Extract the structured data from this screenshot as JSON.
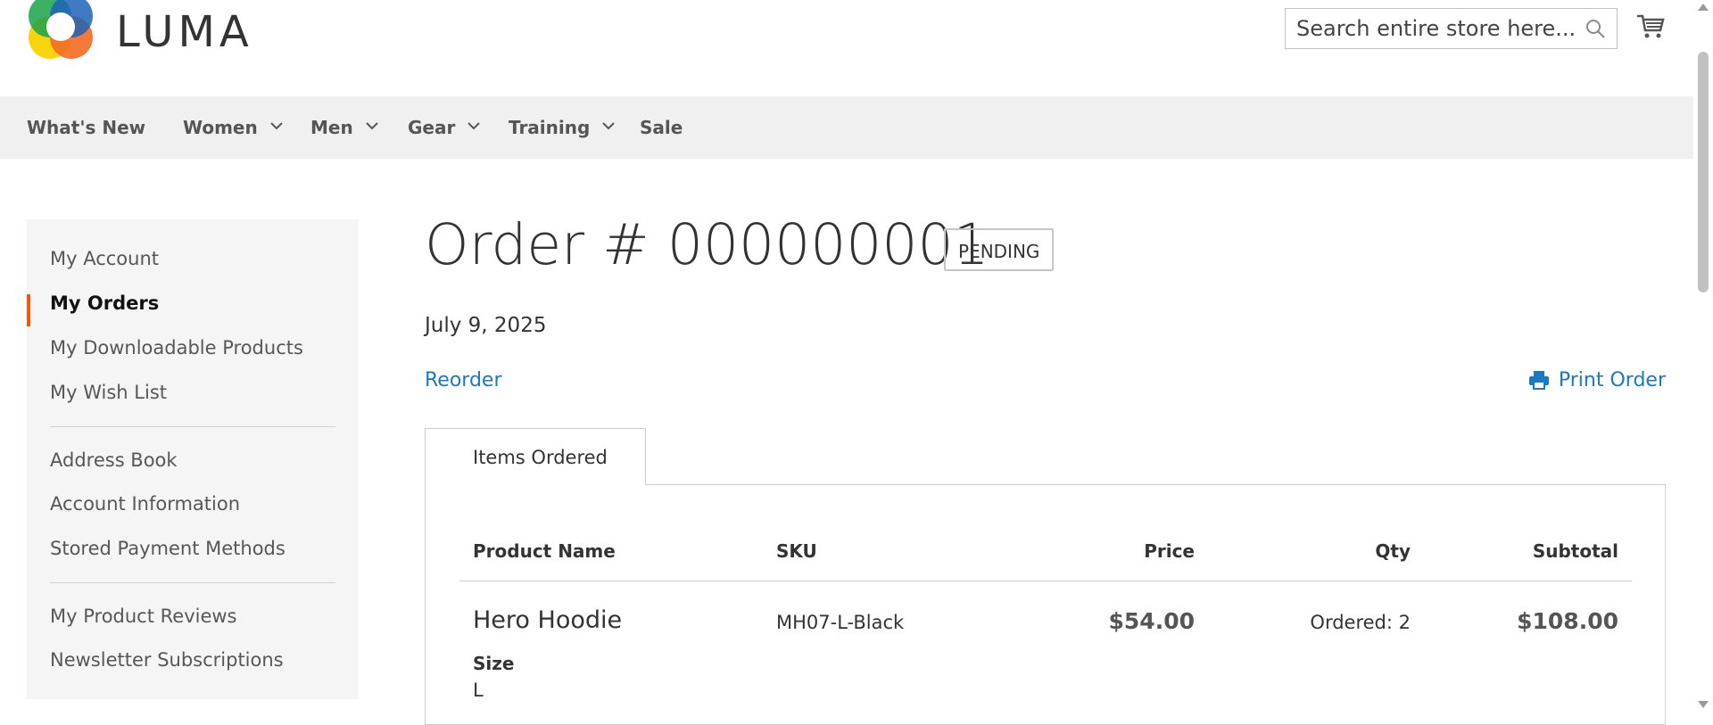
{
  "header": {
    "logo_text": "LUMA",
    "search_placeholder": "Search entire store here...",
    "icons": {
      "search": "search-icon",
      "cart": "cart-icon"
    }
  },
  "nav": {
    "items": [
      {
        "label": "What's New",
        "has_dropdown": false
      },
      {
        "label": "Women",
        "has_dropdown": true
      },
      {
        "label": "Men",
        "has_dropdown": true
      },
      {
        "label": "Gear",
        "has_dropdown": true
      },
      {
        "label": "Training",
        "has_dropdown": true
      },
      {
        "label": "Sale",
        "has_dropdown": false
      }
    ]
  },
  "sidebar": {
    "items": [
      {
        "label": "My Account"
      },
      {
        "label": "My Orders",
        "active": true
      },
      {
        "label": "My Downloadable Products"
      },
      {
        "label": "My Wish List"
      },
      {
        "label": "Address Book"
      },
      {
        "label": "Account Information"
      },
      {
        "label": "Stored Payment Methods"
      },
      {
        "label": "My Product Reviews"
      },
      {
        "label": "Newsletter Subscriptions"
      }
    ]
  },
  "order": {
    "title": "Order # 000000001",
    "status": "PENDING",
    "date": "July 9, 2025",
    "reorder_label": "Reorder",
    "print_label": "Print Order"
  },
  "tabs": {
    "items_ordered": "Items Ordered"
  },
  "table": {
    "headers": {
      "product": "Product Name",
      "sku": "SKU",
      "price": "Price",
      "qty": "Qty",
      "subtotal": "Subtotal"
    },
    "rows": [
      {
        "product": "Hero Hoodie",
        "option_label": "Size",
        "option_value": "L",
        "sku": "MH07-L-Black",
        "price": "$54.00",
        "qty": "Ordered: 2",
        "subtotal": "$108.00"
      }
    ]
  },
  "colors": {
    "accent": "#ff5501",
    "link": "#1979c3",
    "nav_bg": "#f0f0f0",
    "sidebar_bg": "#f5f5f5"
  }
}
